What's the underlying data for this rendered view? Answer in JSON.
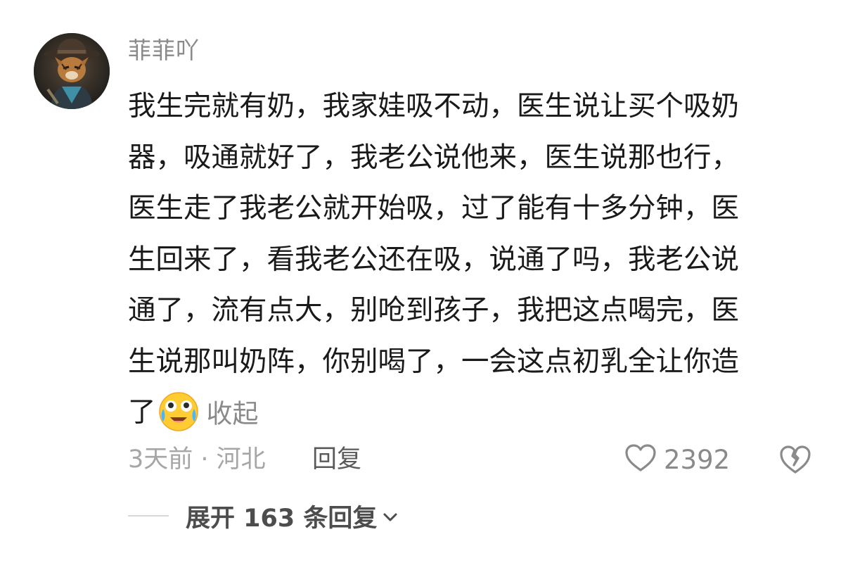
{
  "comment": {
    "username": "菲菲吖",
    "lines": [
      "我生完就有奶，我家娃吸不动，医生说让买个吸奶",
      "器，吸通就好了，我老公说他来，医生说那也行，",
      "医生走了我老公就开始吸，过了能有十多分钟，医",
      "生回来了，看我老公还在吸，说通了吗，我老公说",
      "通了，流有点大，别呛到孩子，我把这点喝完，医",
      "生说那叫奶阵，你别喝了，一会这点初乳全让你造",
      "了"
    ],
    "emoji": "crying-laughing-emoji",
    "collapse_label": "收起",
    "meta": "3天前 · 河北",
    "reply_label": "回复",
    "like_count": "2392",
    "expand_label": "展开 163 条回复"
  },
  "colors": {
    "muted": "#8a8a8a",
    "text": "#1a1a1a",
    "emoji_yellow": "#ffcc33"
  }
}
